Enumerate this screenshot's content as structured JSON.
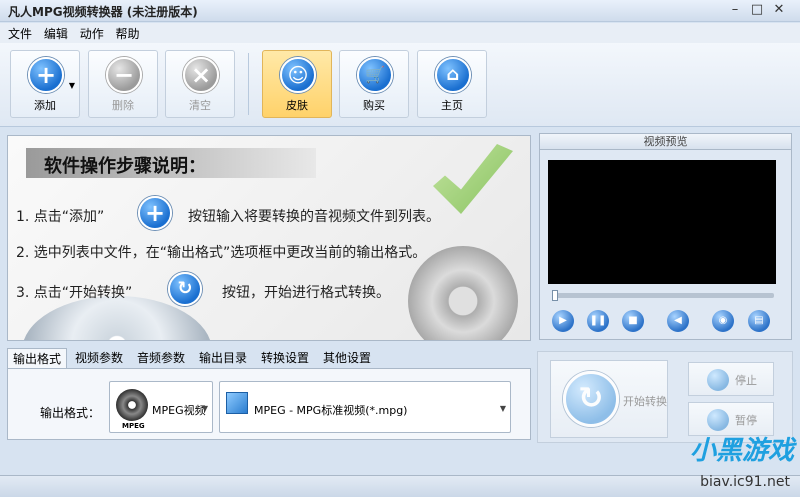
{
  "window": {
    "title": "凡人MPG视频转换器   (未注册版本)",
    "minimize": "–",
    "maximize": "□",
    "close": "✕"
  },
  "menu": [
    "文件",
    "编辑",
    "动作",
    "帮助"
  ],
  "toolbar": {
    "add": "添加",
    "delete": "删除",
    "clear": "清空",
    "skin": "皮肤",
    "buy": "购买",
    "home": "主页"
  },
  "guide": {
    "heading": "软件操作步骤说明：",
    "step1_a": "1. 点击“添加”",
    "step1_b": "按钮输入将要转换的音视频文件到列表。",
    "step2": "2. 选中列表中文件，在“输出格式”选项框中更改当前的输出格式。",
    "step3_a": "3. 点击“开始转换”",
    "step3_b": "按钮，开始进行格式转换。"
  },
  "preview": {
    "title": "视频预览",
    "progress": 0
  },
  "tabs": [
    "输出格式",
    "视频参数",
    "音频参数",
    "输出目录",
    "转换设置",
    "其他设置"
  ],
  "output": {
    "label": "输出格式：",
    "category": "MPEG视频",
    "category_icon_text": "MPEG",
    "format": "MPEG - MPG标准视频(*.mpg)"
  },
  "convert": {
    "start": "开始转换",
    "stop": "停止",
    "pause": "暂停"
  },
  "watermark": {
    "logo": "小黑游戏",
    "url": "biav.ic91.net"
  }
}
